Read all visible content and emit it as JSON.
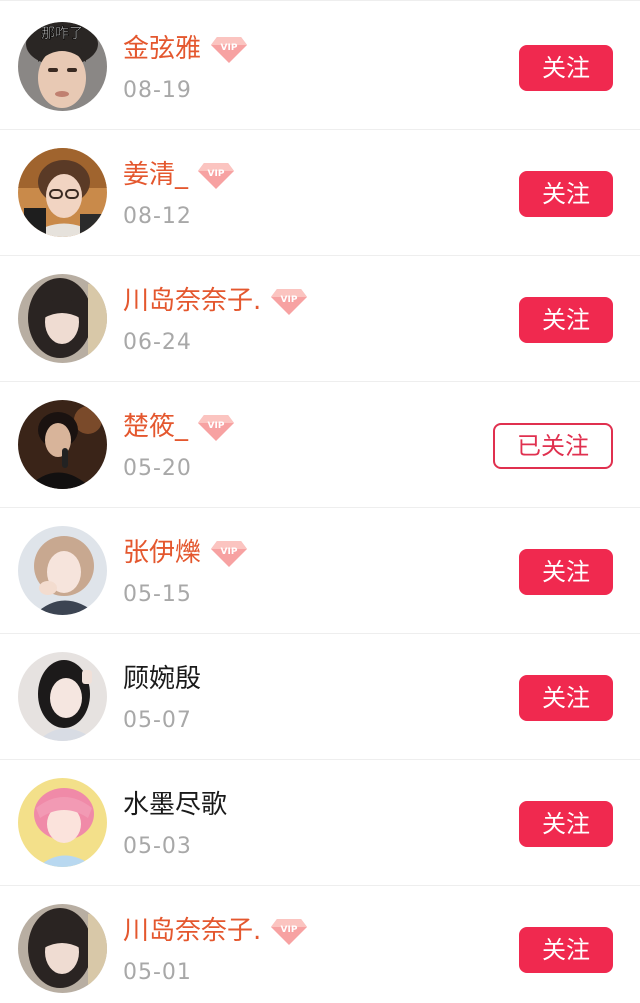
{
  "colors": {
    "accent": "#f0294f",
    "vip_name": "#e4572e",
    "date_text": "#a8a8a8",
    "divider": "#eeeeee"
  },
  "vip_badge_text": "VIP",
  "items": [
    {
      "name": "金弦雅",
      "date": "08-19",
      "vip": true,
      "button": "关注",
      "followed": false,
      "avatar_caption": "那咋了"
    },
    {
      "name": "姜清_",
      "date": "08-12",
      "vip": true,
      "button": "关注",
      "followed": false
    },
    {
      "name": "川岛奈奈子.",
      "date": "06-24",
      "vip": true,
      "button": "关注",
      "followed": false
    },
    {
      "name": "楚筱_",
      "date": "05-20",
      "vip": true,
      "button": "已关注",
      "followed": true
    },
    {
      "name": "张伊爍",
      "date": "05-15",
      "vip": true,
      "button": "关注",
      "followed": false
    },
    {
      "name": "顾婉殷",
      "date": "05-07",
      "vip": false,
      "button": "关注",
      "followed": false
    },
    {
      "name": "水墨尽歌",
      "date": "05-03",
      "vip": false,
      "button": "关注",
      "followed": false
    },
    {
      "name": "川岛奈奈子.",
      "date": "05-01",
      "vip": true,
      "button": "关注",
      "followed": false
    }
  ]
}
